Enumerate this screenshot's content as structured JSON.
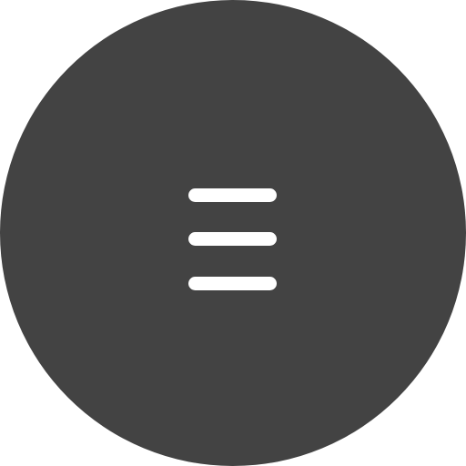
{
  "button": {
    "icon": "hamburger-menu-icon",
    "background_color": "#434343",
    "icon_color": "#ffffff",
    "shape": "circle"
  }
}
